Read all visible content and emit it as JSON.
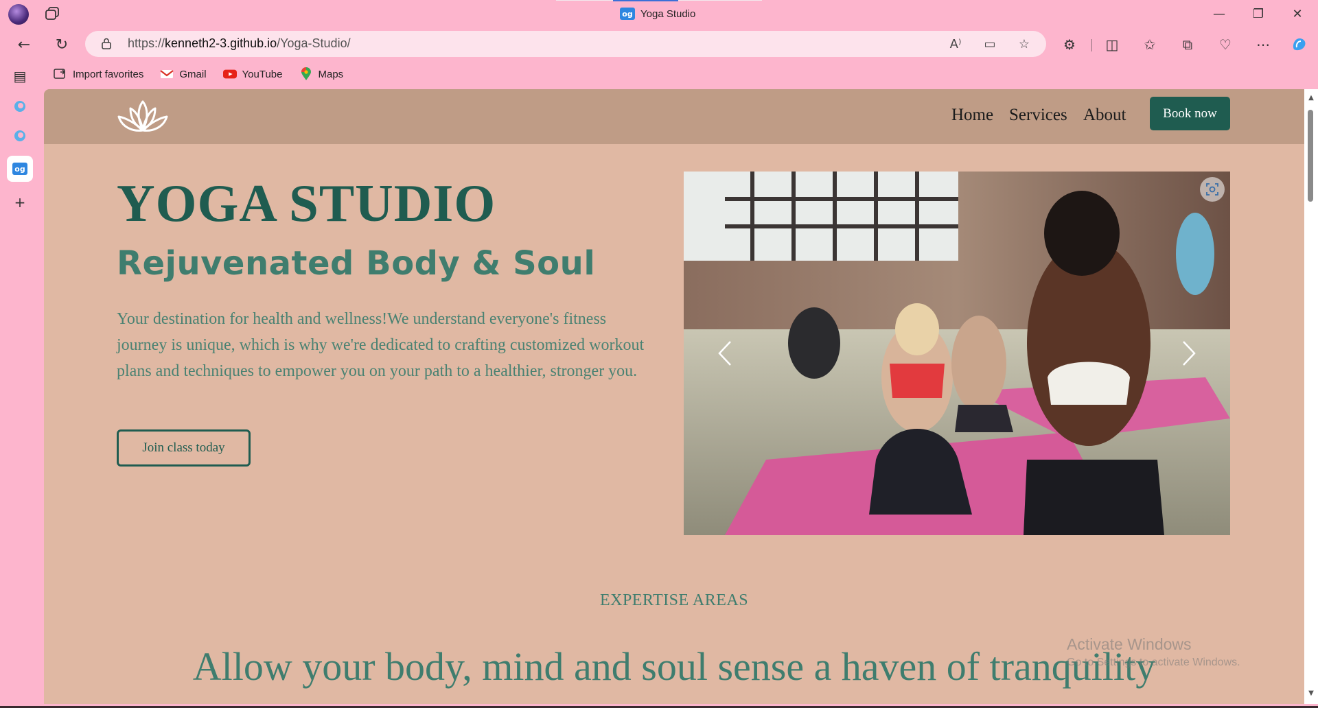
{
  "browser": {
    "tab_title": "Yoga Studio",
    "favicon_text": "og",
    "url_prefix": "https://",
    "url_host": "kenneth2-3.github.io",
    "url_path": "/Yoga-Studio/",
    "favorites": [
      {
        "label": "Import favorites",
        "icon": "import-icon"
      },
      {
        "label": "Gmail",
        "icon": "gmail-icon"
      },
      {
        "label": "YouTube",
        "icon": "youtube-icon"
      },
      {
        "label": "Maps",
        "icon": "maps-icon"
      }
    ],
    "window_controls": {
      "minimize": "—",
      "restore": "❐",
      "close": "✕"
    },
    "accent_color": "#3b6fd8"
  },
  "site": {
    "nav": {
      "home": "Home",
      "services": "Services",
      "about": "About",
      "book": "Book now"
    },
    "hero": {
      "title": "YOGA STUDIO",
      "subtitle": "Rejuvenated Body & Soul",
      "description": "Your destination for health and wellness!We understand everyone's fitness journey is unique, which is why we're dedicated to crafting customized workout plans and techniques to empower you on your path to a healthier, stronger you.",
      "cta": "Join class today"
    },
    "section": {
      "eyebrow": "EXPERTISE AREAS",
      "heading": "Allow your body, mind and soul sense a haven of tranquility"
    },
    "colors": {
      "primary": "#1f5c50",
      "header_bg": "#bf9c86",
      "page_bg": "#e0b8a3",
      "text_green": "#3f7d6e"
    }
  },
  "os": {
    "watermark_title": "Activate Windows",
    "watermark_sub": "Go to Settings to activate Windows."
  }
}
